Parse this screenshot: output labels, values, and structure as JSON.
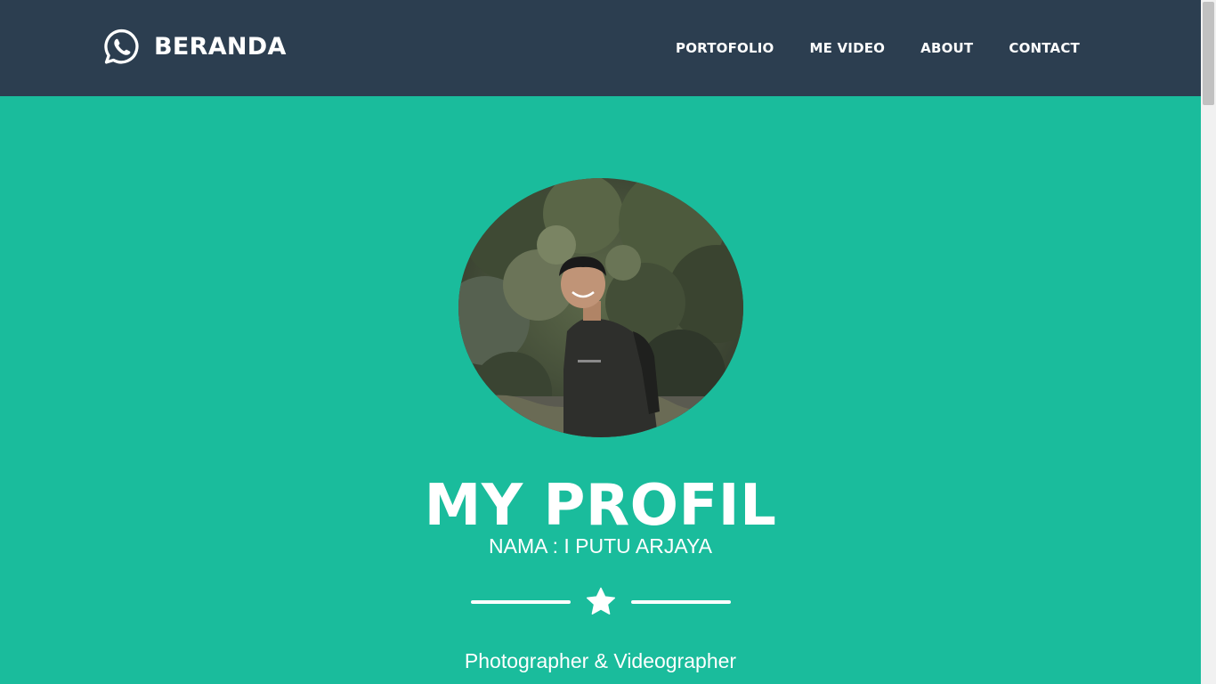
{
  "navbar": {
    "brand_icon": "whatsapp-icon",
    "brand_label": "BERANDA",
    "links": [
      {
        "label": "PORTOFOLIO"
      },
      {
        "label": "ME VIDEO"
      },
      {
        "label": "ABOUT"
      },
      {
        "label": "CONTACT"
      }
    ]
  },
  "hero": {
    "title": "MY PROFIL",
    "name": "NAMA : I PUTU ARJAYA",
    "divider_icon": "star-icon",
    "subtitle": "Photographer & Videographer"
  },
  "colors": {
    "navbar_bg": "#2c3e50",
    "hero_bg": "#1abc9c",
    "text": "#ffffff"
  }
}
